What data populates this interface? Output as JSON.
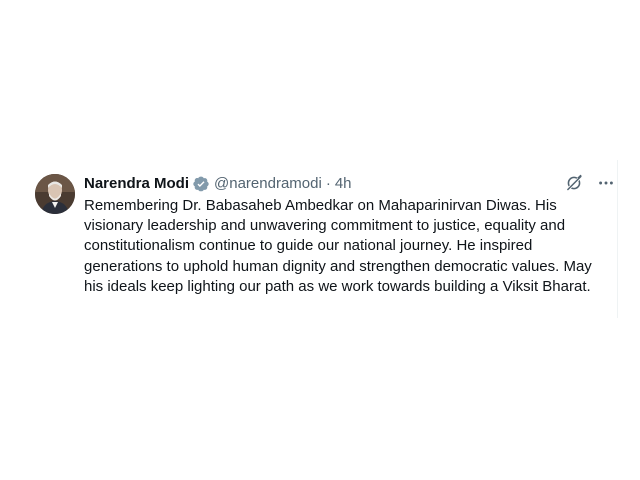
{
  "tweet": {
    "author_name": "Narendra Modi",
    "handle": "@narendramodi",
    "separator": "·",
    "time": "4h",
    "text": "Remembering Dr. Babasaheb Ambedkar on Mahaparinirvan Diwas. His visionary leadership and unwavering commitment to justice, equality and constitutionalism continue to guide our national journey. He inspired generations to uphold human dignity and strengthen democratic values. May his ideals keep lighting our path as we work towards building a Viksit Bharat."
  },
  "icons": {
    "verified": "verified-badge-icon",
    "grok": "grok-icon",
    "more": "more-options-icon"
  },
  "colors": {
    "text_primary": "#0f1419",
    "text_secondary": "#536471",
    "verified_badge": "#829aab",
    "background": "#ffffff",
    "divider": "#eff3f4"
  }
}
